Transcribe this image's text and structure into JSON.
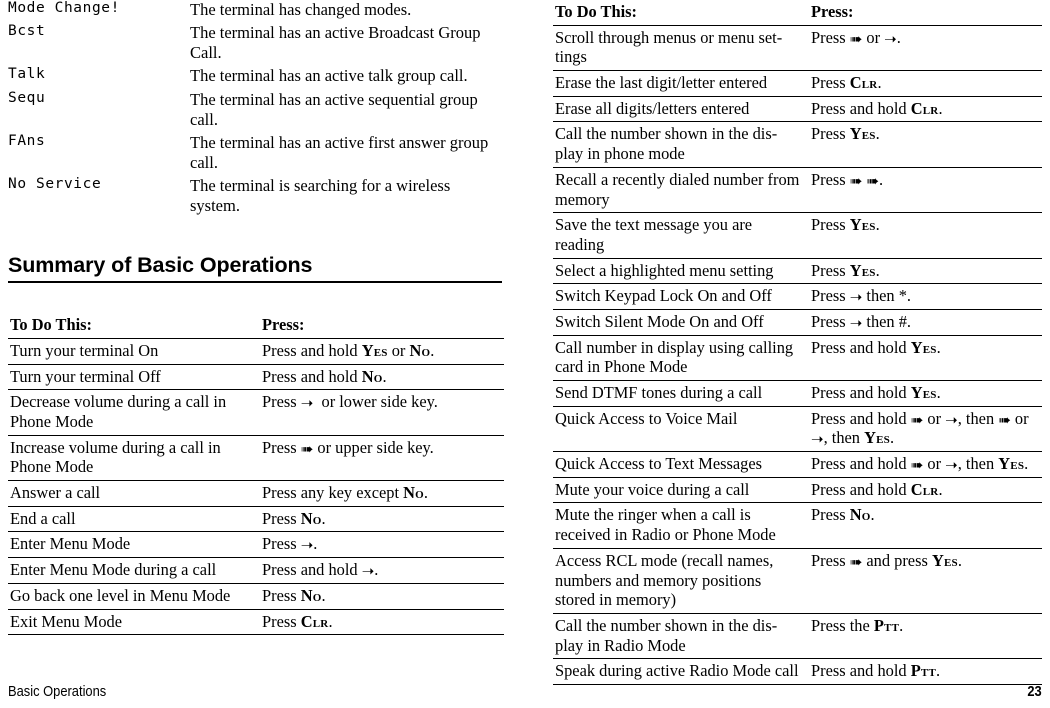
{
  "page": {
    "footer_left": "Basic Operations",
    "footer_page_number": "23"
  },
  "indicators": {
    "rows": [
      {
        "name": "Mode Change!",
        "description": "The terminal has changed modes."
      },
      {
        "name": "Bcst",
        "description": "The terminal has an active Broadcast Group Call."
      },
      {
        "name": "Talk",
        "description": "The terminal has an active talk group call."
      },
      {
        "name": "Sequ",
        "description": "The terminal has an active sequential group call."
      },
      {
        "name": "FAns",
        "description": "The terminal has an active first answer group call."
      },
      {
        "name": "No Service",
        "description": "The terminal is searching for a wireless system."
      }
    ]
  },
  "section": {
    "heading": "Summary of Basic Operations"
  },
  "table_left": {
    "header_do": "To Do This:",
    "header_press": "Press:",
    "rows": [
      {
        "do": "Turn your terminal On",
        "press_html": "Press and hold <span class=\"kc\">Yes</span> or <span class=\"kc\">No</span>."
      },
      {
        "do": "Turn your terminal Off",
        "press_html": "Press and hold <span class=\"kc\">No</span>."
      },
      {
        "do": "Decrease volume during a call in Phone Mode",
        "press_html": "Press <span class=\"arw\">&#10141;</span>&nbsp; or lower side key."
      },
      {
        "do": "Increase volume during a call in Phone Mode",
        "press_html": "Press <span class=\"arw\">&#10144;</span> or upper side key."
      },
      {
        "do": "Answer a call",
        "press_html": "Press any key except <span class=\"kc\">No</span>."
      },
      {
        "do": "End a call",
        "press_html": "Press <span class=\"kc\">No</span>."
      },
      {
        "do": "Enter Menu Mode",
        "press_html": "Press <span class=\"arw\">&#10141;</span>."
      },
      {
        "do": "Enter Menu Mode during a call",
        "press_html": "Press and hold <span class=\"arw\">&#10141;</span>."
      },
      {
        "do": "Go back one level in Menu Mode",
        "press_html": "Press <span class=\"kc\">No</span>."
      },
      {
        "do": "Exit Menu Mode",
        "press_html": "Press <span class=\"kc\">Clr</span>."
      }
    ]
  },
  "table_right": {
    "header_do": "To Do This:",
    "header_press": "Press:",
    "rows": [
      {
        "do": "Scroll through menus or menu set-tings",
        "press_html": "Press <span class=\"arw\">&#10144;</span> or <span class=\"arw\">&#10141;</span>."
      },
      {
        "do": "Erase the last digit/letter entered",
        "press_html": "Press <span class=\"kc\">Clr</span>."
      },
      {
        "do": "Erase all digits/letters entered",
        "press_html": "Press and hold <span class=\"kc\">Clr</span>."
      },
      {
        "do": "Call the number shown in the dis-play in phone mode",
        "press_html": "Press <span class=\"kc\">Yes</span>."
      },
      {
        "do": "Recall a recently dialed number from memory",
        "press_html": "Press <span class=\"arw\">&#10144;</span> <span class=\"arw\">&#10144;</span>."
      },
      {
        "do": "Save the text message you are reading",
        "press_html": "Press <span class=\"kc\">Yes</span>."
      },
      {
        "do": "Select a highlighted menu setting",
        "press_html": "Press <span class=\"kc\">Yes</span>."
      },
      {
        "do": "Switch Keypad Lock On and Off",
        "press_html": "Press <span class=\"arw\">&#10141;</span> then *."
      },
      {
        "do": "Switch Silent Mode On and Off",
        "press_html": "Press <span class=\"arw\">&#10141;</span> then #."
      },
      {
        "do": "Call number in display using calling card in Phone Mode",
        "press_html": "Press and hold <span class=\"kc\">Yes</span>."
      },
      {
        "do": "Send DTMF tones during a call",
        "press_html": "Press and hold <span class=\"kc\">Yes</span>."
      },
      {
        "do": "Quick Access to Voice Mail",
        "press_html": "Press and hold <span class=\"arw\">&#10144;</span> or <span class=\"arw\">&#10141;</span>, then <span class=\"arw\">&#10144;</span> or <span class=\"arw\">&#10141;</span>, then <span class=\"kc\">Yes</span>."
      },
      {
        "do": "Quick Access to Text Messages",
        "press_html": "Press and hold <span class=\"arw\">&#10144;</span> or <span class=\"arw\">&#10141;</span>, then <span class=\"kc\">Yes</span>."
      },
      {
        "do": "Mute your voice during a call",
        "press_html": "Press and hold <span class=\"kc\">Clr</span>."
      },
      {
        "do": "Mute the ringer when a call is received in Radio or Phone Mode",
        "press_html": "Press <span class=\"kc\">No</span>."
      },
      {
        "do": "Access RCL mode (recall names, numbers and memory positions stored in memory)",
        "press_html": "Press <span class=\"arw\">&#10144;</span> and press <span class=\"kc\">Yes</span>."
      },
      {
        "do": "Call the number shown in the dis-play in Radio Mode",
        "press_html": "Press the <span class=\"kc\">Ptt</span>."
      },
      {
        "do": "Speak during active Radio Mode call",
        "press_html": "Press and hold <span class=\"kc\">Ptt</span>."
      }
    ]
  }
}
